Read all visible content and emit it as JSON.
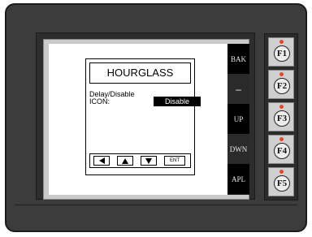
{
  "dialog": {
    "title": "HOURGLASS",
    "field_label_line1": "Delay/Disable",
    "field_label_line2": "ICON:",
    "field_value": "Disable",
    "nav": {
      "left_icon": "left-triangle-icon",
      "up_icon": "up-triangle-icon",
      "down_icon": "down-triangle-icon",
      "ent_label": "ENT"
    }
  },
  "side_keys": [
    "BAK",
    "–",
    "UP",
    "DWN",
    "APL"
  ],
  "function_keys": [
    "F1",
    "F2",
    "F3",
    "F4",
    "F5"
  ],
  "colors": {
    "housing": "#3c3c3c",
    "led": "#e14a2c",
    "selected_value_bg": "#000000"
  }
}
